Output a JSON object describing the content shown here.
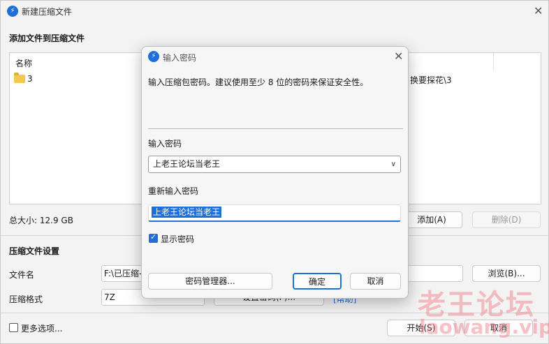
{
  "main_window": {
    "title": "新建压缩文件",
    "section_title": "添加文件到压缩文件",
    "list": {
      "column_name": "名称",
      "items": [
        {
          "name": "3",
          "icon": "folder-icon"
        }
      ],
      "partial_path": "换要探花\\3"
    },
    "total_size": "总大小: 12.9 GB",
    "add_button": "添加(A)",
    "delete_button": "删除(D)",
    "settings_title": "压缩文件设置",
    "filename_label": "文件名",
    "filename_value": "F:\\已压缩-",
    "browse_button": "浏览(B)...",
    "format_label": "压缩格式",
    "format_value": "7Z",
    "set_password_partial": "设置密码(P)...",
    "link_partial": "[帮助]",
    "more_options": "更多选项...",
    "start_button": "开始(S)",
    "cancel_button": "取消"
  },
  "dialog": {
    "title": "输入密码",
    "description": "输入压缩包密码。建议使用至少 8 位的密码来保证安全性。",
    "password_label": "输入密码",
    "password_value": "上老王论坛当老王",
    "repeat_label": "重新输入密码",
    "repeat_value": "上老王论坛当老王",
    "show_password_label": "显示密码",
    "show_password_checked": true,
    "manager_button": "密码管理器...",
    "ok_button": "确定",
    "cancel_button": "取消"
  },
  "watermark": {
    "text_cn": "老王论坛",
    "text_en": "laowang.vip"
  },
  "colors": {
    "accent": "#1e6fd9",
    "window_bg": "#f3f3f3",
    "watermark": "#f07882"
  }
}
